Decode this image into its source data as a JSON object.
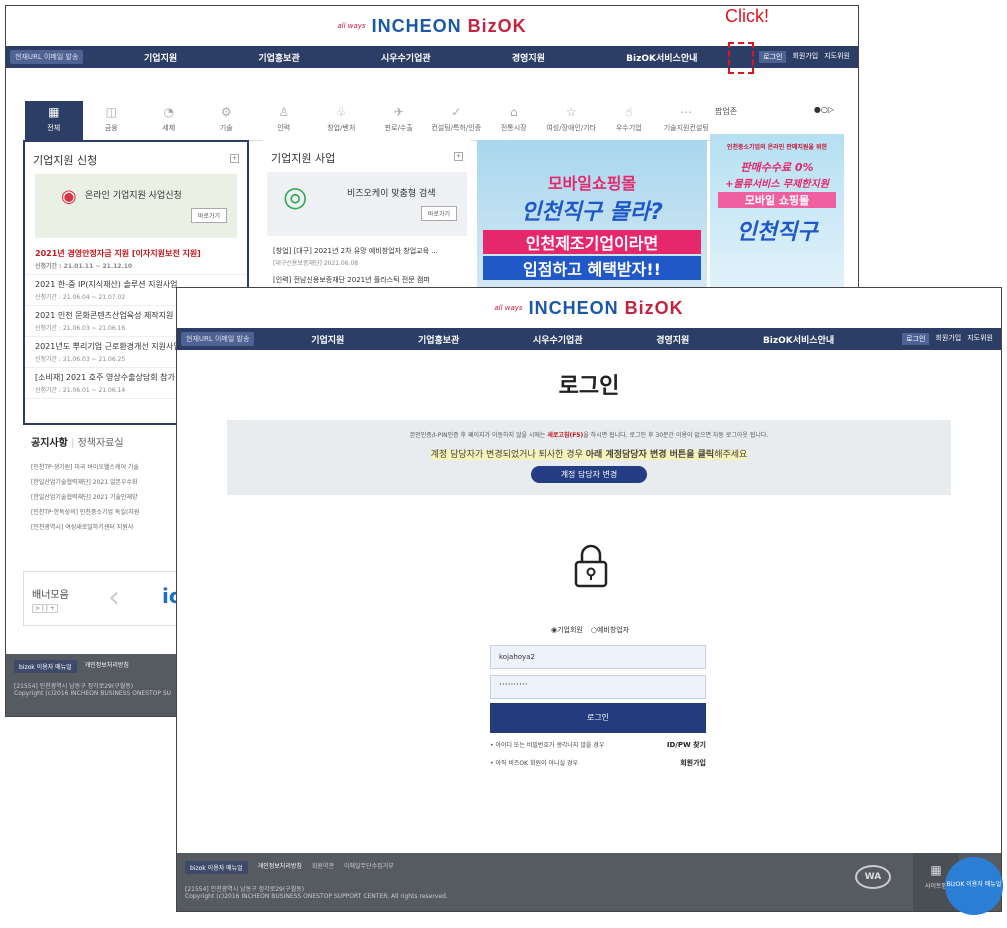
{
  "annotation": {
    "text": "Click!",
    "color": "#e0141e"
  },
  "brand": {
    "tag": "all ways",
    "name": "INCHEON",
    "sub": "BizOK"
  },
  "back": {
    "email_btn": "현재URL 이메일 발송",
    "menu": [
      "기업지원",
      "기업홍보관",
      "시우수기업관",
      "경영지원",
      "BizOK서비스안내"
    ],
    "util": [
      "로그인",
      "회원가입",
      "지도위원"
    ],
    "categories": [
      "전체",
      "금융",
      "세제",
      "기술",
      "인력",
      "창업/벤처",
      "판로/수출",
      "컨설팅/특허/인증",
      "전통시장",
      "여성/장애인/기타",
      "우수기업",
      "기술지원컨설팅"
    ],
    "popup_title": "팝업존",
    "support": {
      "title": "기업지원 신청",
      "promo": "온라인 기업지원 사업신청",
      "go": "바로가기",
      "items": [
        {
          "title": "2021년 경영안정자금 지원 [이자지원보전 지원]",
          "date": "신청기간 : 21.01.11 ~ 21.12.10"
        },
        {
          "title": "2021 한-중 IP(지식재산) 솔루션 지원사업",
          "date": "신청기간 : 21.06.04 ~ 21.07.02"
        },
        {
          "title": "2021 인천 문화콘텐츠산업육성 제작지원",
          "date": "신청기간 : 21.06.03 ~ 21.06.16"
        },
        {
          "title": "2021년도 뿌리기업 근로환경개선 지원사업",
          "date": "신청기간 : 21.06.03 ~ 21.06.25"
        },
        {
          "title": "[소비재] 2021 호주 영상수출상담회 참가",
          "date": "신청기간 : 21.06.01 ~ 21.06.14"
        }
      ]
    },
    "business": {
      "title": "기업지원 사업",
      "promo": "비즈오케이 맞춤형 검색",
      "go": "바로가기",
      "items": [
        {
          "title": "[창업] [대구] 2021년 2차 유망 예비창업자 창업교육 ...",
          "date": "[대구신용보증재단] 2021.06.08"
        },
        {
          "title": "[인력] 전남신용보증재단 2021년 플라스틱 전문 캠퍼",
          "date": ""
        }
      ]
    },
    "ad1": {
      "line1": "모바일쇼핑몰",
      "line2": "인천직구 몰라?",
      "line3": "인천제조기업이라면",
      "line4": "입점하고 혜택받자!!"
    },
    "ad2": {
      "line1": "인천중소기업의 온라인 판매지원을 위한",
      "line2": "판매수수료 0%",
      "line3": "+물류서비스 무제한지원",
      "line4": "모바일 쇼핑몰",
      "line5": "인천직구"
    },
    "notice": {
      "tab1": "공지사항",
      "tab2": "정책자료실",
      "items": [
        "[인천TP·생기원] 미국 바이오헬스케어 기술",
        "[한일산업기술협력재단] 2021 일본우수화",
        "[한일산업기술협력재단] 2021 기술인재양",
        "[인천TP·한독상의] 인천중소기업 독일(자원",
        "[인천광역시] 여성새로일하기센터 지원사"
      ]
    },
    "banner_title": "배너모음",
    "footer": {
      "links": [
        "bizok 이용자 매뉴얼",
        "개인정보처리방침"
      ],
      "address": "[21554] 인천광역시 남동구 정각로29(구월동)",
      "copyright": "Copyright (c)2016 INCHEON BUSINESS ONESTOP SU"
    }
  },
  "front": {
    "email_btn": "현재URL 이메일 발송",
    "menu": [
      "기업지원",
      "기업홍보관",
      "시우수기업관",
      "경영지원",
      "BizOK서비스안내"
    ],
    "util": [
      "로그인",
      "회원가입",
      "지도위원"
    ],
    "title": "로그인",
    "info1_pre": "본인인증/I-PIN인증 후 페이지가 이동하지 않을 시에는 ",
    "info1_red": "새로고침(F5)",
    "info1_post": "을 하시면 됩니다. 로그인 후 30분간 이용이 없으면 자동 로그아웃 됩니다.",
    "info2_pre": "계정 담당자가 변경되었거나 퇴사한 경우 ",
    "info2_bold": "아래 계정담당자 변경 버튼을 클릭",
    "info2_post": "해주세요",
    "manager_btn": "계정 담당자 변경",
    "radio1": "기업회원",
    "radio2": "예비창업자",
    "user_id": "kojahoya2",
    "password": "··········",
    "login_btn": "로그인",
    "help1": "• 아이디 또는 비밀번호가 생각나지 않을 경우",
    "help1_link": "ID/PW 찾기",
    "help2": "• 아직 비즈OK 회원이 아니실 경우",
    "help2_link": "회원가입",
    "footer": {
      "links": [
        "bizok 이용자 매뉴얼",
        "개인정보처리방침",
        "회원약관",
        "이메일무단수집거부"
      ],
      "address": "[21554] 인천광역시 남동구 정각로29(구월동)",
      "copyright": "Copyright (c)2016 INCHEON BUSINESS ONESTOP SUPPORT CENTER. All rights reserved."
    },
    "sitemap": "사이트맵",
    "user_manual": "BizOK 이용자 매뉴얼"
  }
}
